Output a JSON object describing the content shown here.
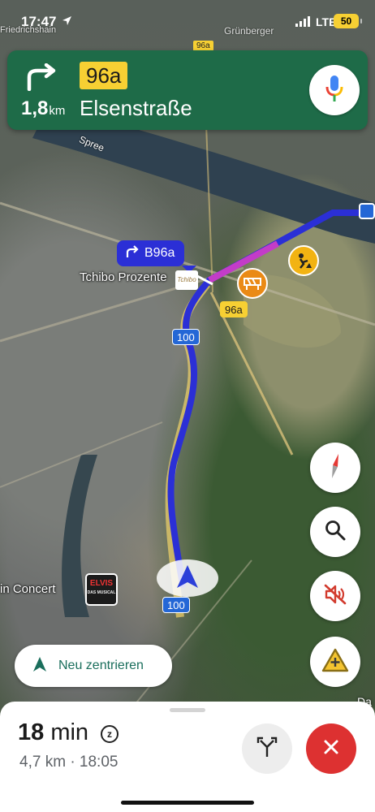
{
  "status_bar": {
    "time": "17:47",
    "network": "LTE",
    "battery": "50",
    "location_icon": "location-arrow-icon",
    "signal_icon": "cellular-signal-icon"
  },
  "map_labels": {
    "top_left": "Friedrichshain",
    "top_right": "Grünberger",
    "top_sign": "96a",
    "river": "Spree",
    "tchibo_label": "Tchibo Prozente",
    "tchibo_logo": "Tchibo",
    "concert_label": "in Concert",
    "elvis_logo": "ELVIS",
    "elvis_sub": "DAS MUSICAL",
    "edge_label": "Da",
    "road_sign_upper": "100",
    "road_sign_lower": "100",
    "road_sign_96a": "96a"
  },
  "navigation": {
    "turn_icon": "turn-right-arrow-icon",
    "distance_value": "1,8",
    "distance_unit": "km",
    "route_number": "96a",
    "street": "Elsenstraße",
    "mic_icon": "microphone-icon"
  },
  "callout": {
    "icon": "turn-right-arrow-icon",
    "label": "B96a"
  },
  "incidents": [
    {
      "name": "roadwork-icon",
      "color": "#f2b313"
    },
    {
      "name": "road-closure-icon",
      "color": "#ea8a16"
    }
  ],
  "map_buttons": {
    "compass": "compass-icon",
    "search": "search-icon",
    "mute": "sound-muted-icon",
    "report": "report-incident-icon"
  },
  "recenter": {
    "label": "Neu zentrieren",
    "icon": "navigation-arrow-icon"
  },
  "eta": {
    "duration_value": "18",
    "duration_unit": "min",
    "sleep_badge": "z",
    "distance": "4,7 km",
    "separator": "·",
    "arrival": "18:05"
  },
  "actions": {
    "routes_icon": "alternate-routes-icon",
    "exit_icon": "close-icon"
  },
  "colors": {
    "banner": "#1e6b48",
    "route": "#2b2fd6",
    "exit": "#dd3131",
    "route_sign": "#f7d033"
  }
}
